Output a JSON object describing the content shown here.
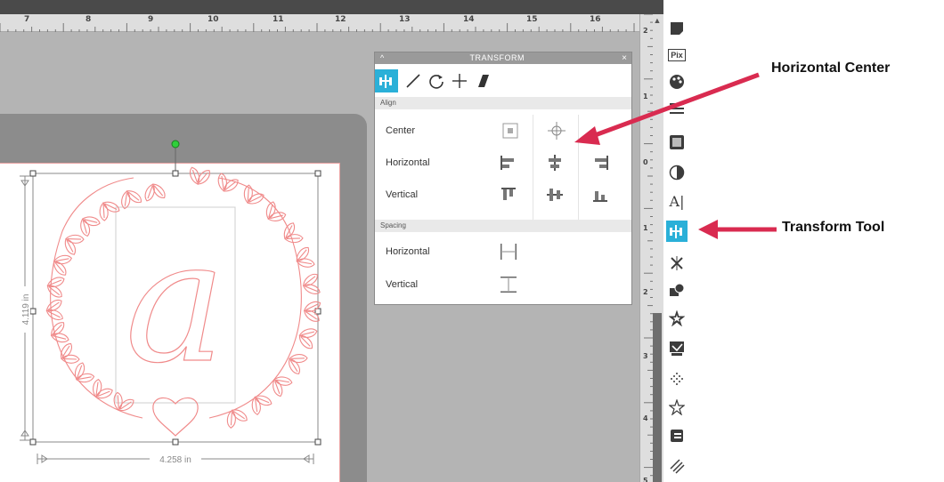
{
  "ruler": {
    "h_numbers": [
      "7",
      "8",
      "9",
      "10",
      "11",
      "12",
      "13",
      "14",
      "15",
      "16"
    ],
    "v_numbers": [
      "2",
      "1",
      "0",
      "1",
      "2",
      "3",
      "4",
      "5"
    ]
  },
  "panel": {
    "title": "TRANSFORM",
    "collapse_glyph": "^",
    "close_glyph": "×",
    "align_section": "Align",
    "align_rows": [
      {
        "label": "Center"
      },
      {
        "label": "Horizontal"
      },
      {
        "label": "Vertical"
      }
    ],
    "spacing_section": "Spacing",
    "spacing_rows": [
      {
        "label": "Horizontal"
      },
      {
        "label": "Vertical"
      }
    ]
  },
  "design": {
    "letter": "a",
    "height_label": "4.119 in",
    "width_label": "4.258 in"
  },
  "toolbar": {
    "pix_label": "Pix",
    "text_tool_glyph": "A|"
  },
  "annotations": {
    "horizontal_center": "Horizontal Center",
    "transform_tool": "Transform Tool"
  },
  "colors": {
    "accent": "#2ab0d8",
    "arrow": "#d92b50",
    "design_stroke": "#f08a8a",
    "handle_green": "#2fcf3a"
  }
}
